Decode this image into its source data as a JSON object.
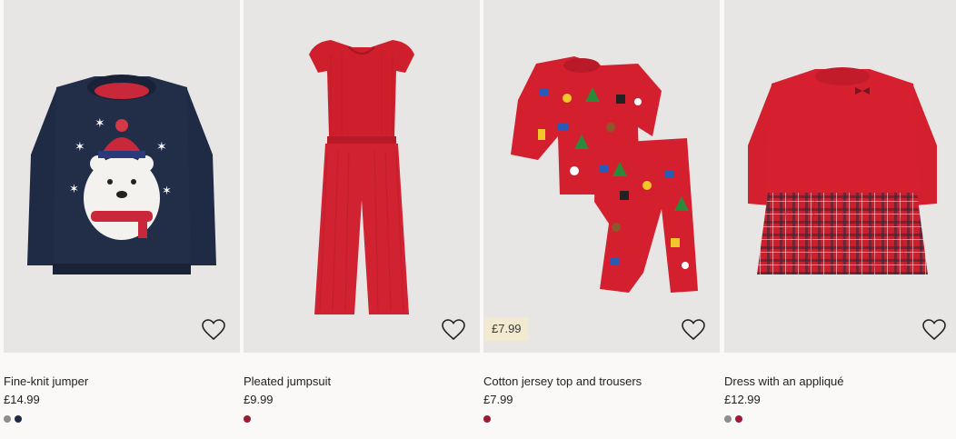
{
  "products": [
    {
      "title": "Fine-knit jumper",
      "price": "£14.99",
      "promo_price": "",
      "swatches": [
        "#8e8e8e",
        "#1f2a44"
      ]
    },
    {
      "title": "Pleated jumpsuit",
      "price": "£9.99",
      "promo_price": "",
      "swatches": [
        "#9b1b35"
      ]
    },
    {
      "title": "Cotton jersey top and trousers",
      "price": "£7.99",
      "promo_price": "£7.99",
      "swatches": [
        "#9b1b35"
      ]
    },
    {
      "title": "Dress with an appliqué",
      "price": "£12.99",
      "promo_price": "",
      "swatches": [
        "#8e8e8e",
        "#9b1b35"
      ]
    }
  ],
  "icons": {
    "favourite": "heart-outline-icon"
  }
}
